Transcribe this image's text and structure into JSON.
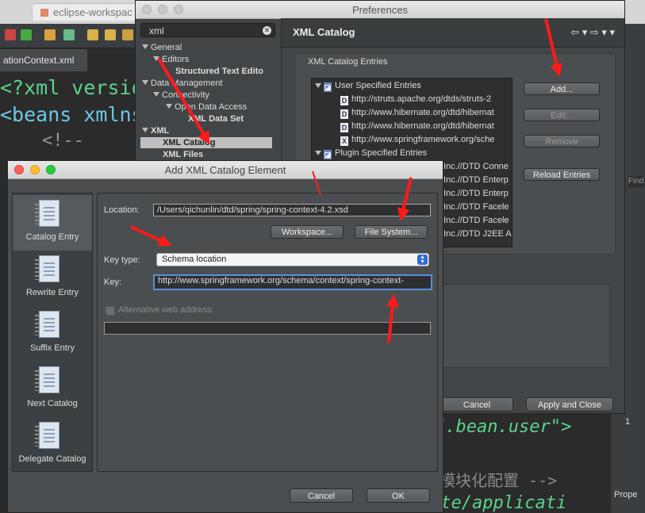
{
  "browser": {
    "tab_title": "eclipse-workspac"
  },
  "editor": {
    "tab_label": "ationContext.xml",
    "code_lines": [
      "<?xml versio",
      "<beans xmlns",
      "    <!--"
    ],
    "code_lower": [
      "J.bean.user\">",
      "模块化配置 -->",
      "nte/applicati"
    ],
    "right_labels": {
      "find": "Find",
      "prop": "Prope",
      "one": "1"
    }
  },
  "preferences": {
    "title": "Preferences",
    "filter_value": "xml",
    "filter_clear": "✕",
    "tree": [
      {
        "label": "General",
        "bold": false
      },
      {
        "label": "Editors",
        "bold": false
      },
      {
        "label": "Structured Text Edito",
        "bold": true
      },
      {
        "label": "Data Management",
        "bold": false
      },
      {
        "label": "Connectivity",
        "bold": false
      },
      {
        "label": "Open Data Access",
        "bold": false
      },
      {
        "label": "XML Data Set",
        "bold": true
      },
      {
        "label": "XML",
        "bold": true
      },
      {
        "label": "XML Catalog",
        "bold": true
      },
      {
        "label": "XML Files",
        "bold": true
      }
    ],
    "page_title": "XML Catalog",
    "nav_icons": "⇦ ▾  ⇨ ▾  ▾",
    "group_label": "XML Catalog Entries",
    "entries": [
      {
        "icon": "◪",
        "label": "User Specified Entries",
        "folder": true
      },
      {
        "icon": "D",
        "label": "http://struts.apache.org/dtds/struts-2",
        "folder": false
      },
      {
        "icon": "D",
        "label": "http://www.hibernate.org/dtd/hibernat",
        "folder": false
      },
      {
        "icon": "D",
        "label": "http://www.hibernate.org/dtd/hibernat",
        "folder": false
      },
      {
        "icon": "X",
        "label": "http://www.springframework.org/sche",
        "folder": false
      },
      {
        "icon": "◪",
        "label": "Plugin Specified Entries",
        "folder": true
      },
      {
        "icon": "",
        "label": "Inc.//DTD Conne",
        "folder": false
      },
      {
        "icon": "",
        "label": "Inc.//DTD Enterp",
        "folder": false
      },
      {
        "icon": "",
        "label": "Inc.//DTD Enterp",
        "folder": false
      },
      {
        "icon": "",
        "label": "Inc.//DTD Facele",
        "folder": false
      },
      {
        "icon": "",
        "label": "Inc.//DTD Facele",
        "folder": false
      },
      {
        "icon": "",
        "label": "Inc.//DTD J2EE A",
        "folder": false
      }
    ],
    "buttons": {
      "add": "Add...",
      "edit": "Edit...",
      "remove": "Remove",
      "reload": "Reload Entries",
      "cancel": "Cancel",
      "apply_close": "Apply and Close"
    }
  },
  "dialog": {
    "title": "Add XML Catalog Element",
    "side_items": [
      {
        "label": "Catalog Entry",
        "selected": true
      },
      {
        "label": "Rewrite Entry",
        "selected": false
      },
      {
        "label": "Suffix Entry",
        "selected": false
      },
      {
        "label": "Next Catalog",
        "selected": false
      },
      {
        "label": "Delegate Catalog",
        "selected": false
      }
    ],
    "location_label": "Location:",
    "location_value": "/Users/qichunlin/dtd/spring/spring-context-4.2.xsd",
    "workspace_button": "Workspace...",
    "filesystem_button": "File System...",
    "keytype_label": "Key type:",
    "keytype_value": "Schema location",
    "key_label": "Key:",
    "key_value": "http://www.springframework.org/schema/context/spring-context-",
    "alt_label": "Alternative web address:",
    "alt_value": "",
    "cancel": "Cancel",
    "ok": "OK"
  },
  "colors": {
    "annotation": "#ff1a1a",
    "accent": "#2f6bd6"
  }
}
